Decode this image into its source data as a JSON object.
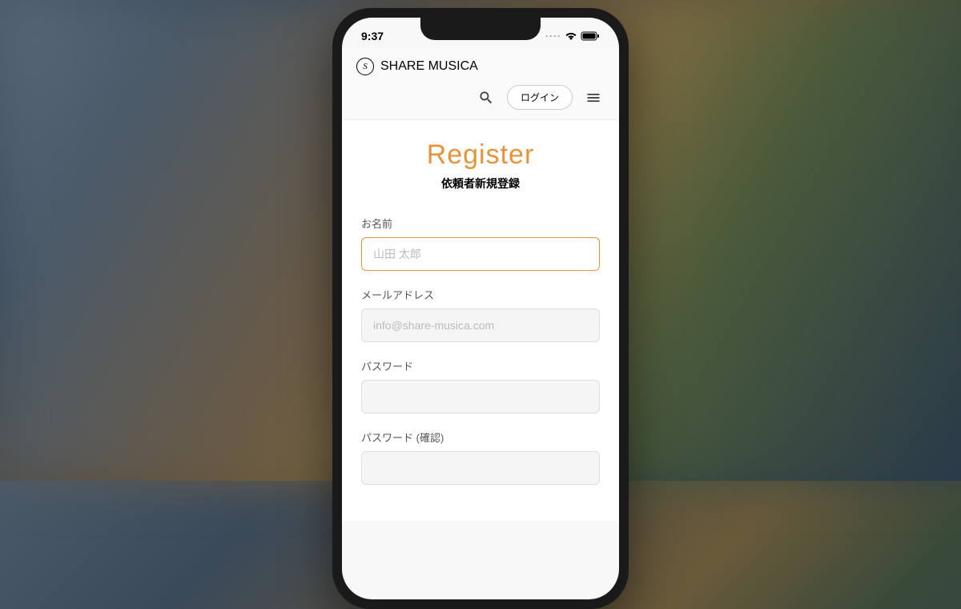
{
  "status_bar": {
    "time": "9:37"
  },
  "header": {
    "brand": "SHARE MUSICA",
    "login_label": "ログイン"
  },
  "page": {
    "title": "Register",
    "subtitle": "依頼者新規登録"
  },
  "form": {
    "name": {
      "label": "お名前",
      "placeholder": "山田 太郎",
      "value": ""
    },
    "email": {
      "label": "メールアドレス",
      "placeholder": "info@share-musica.com",
      "value": ""
    },
    "password": {
      "label": "パスワード",
      "placeholder": "",
      "value": ""
    },
    "password_confirm": {
      "label": "パスワード (確認)",
      "placeholder": "",
      "value": ""
    }
  },
  "colors": {
    "accent": "#e8933a"
  }
}
